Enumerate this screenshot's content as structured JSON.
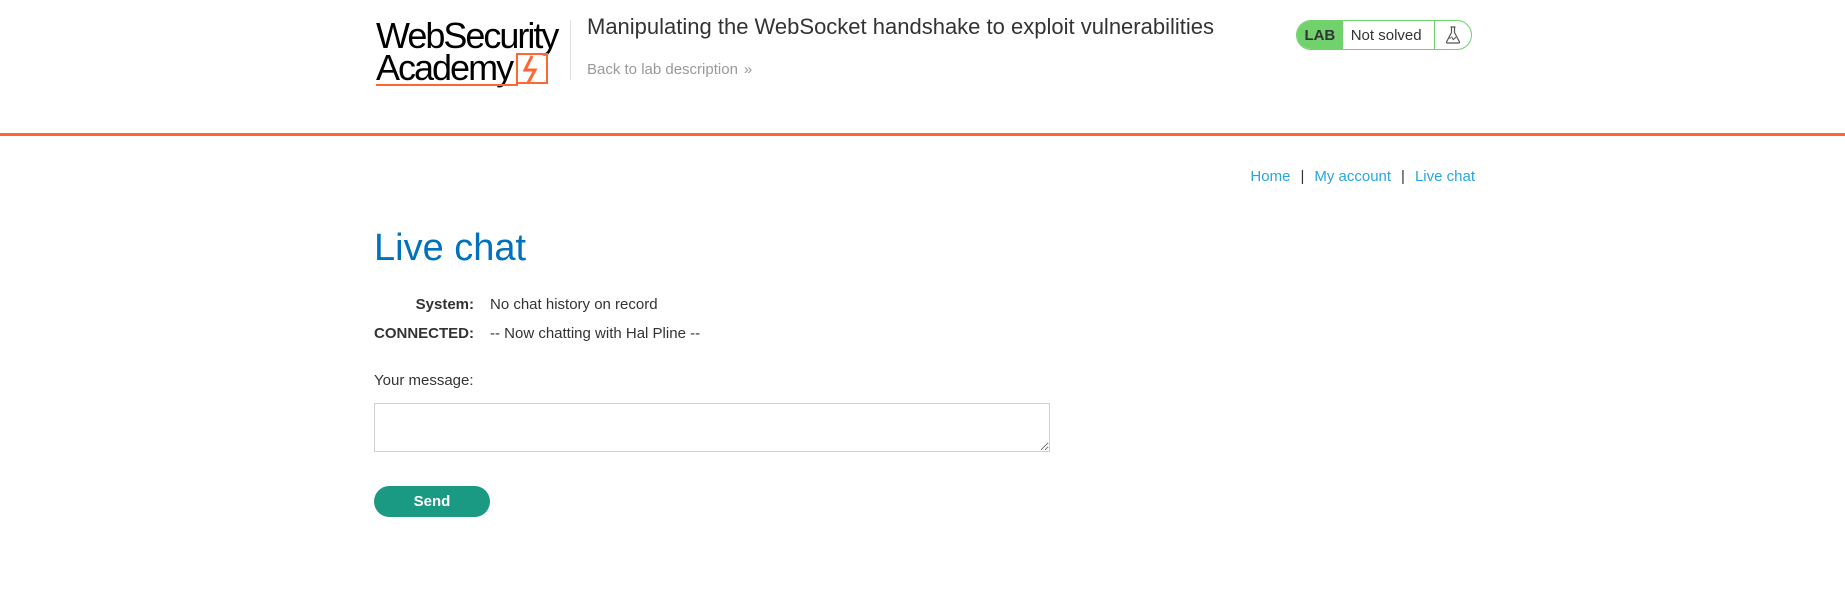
{
  "header": {
    "logo_line1": "WebSecurity",
    "logo_line2": "Academy",
    "lab_title": "Manipulating the WebSocket handshake to exploit vulnerabilities",
    "back_link": "Back to lab description",
    "lab_badge": "LAB",
    "lab_status": "Not solved",
    "accent_color": "#ff6633",
    "status_color": "#70d16d"
  },
  "nav": {
    "items": [
      {
        "label": "Home"
      },
      {
        "label": "My account"
      },
      {
        "label": "Live chat"
      }
    ],
    "separator": "|"
  },
  "main": {
    "title": "Live chat",
    "chat": [
      {
        "who": "System:",
        "message": "No chat history on record"
      },
      {
        "who": "CONNECTED:",
        "message": "-- Now chatting with Hal Pline --"
      }
    ],
    "message_label": "Your message:",
    "message_value": "",
    "send_label": "Send",
    "title_color": "#0071bc",
    "button_color": "#1a9a82",
    "link_color": "#29a6df"
  }
}
